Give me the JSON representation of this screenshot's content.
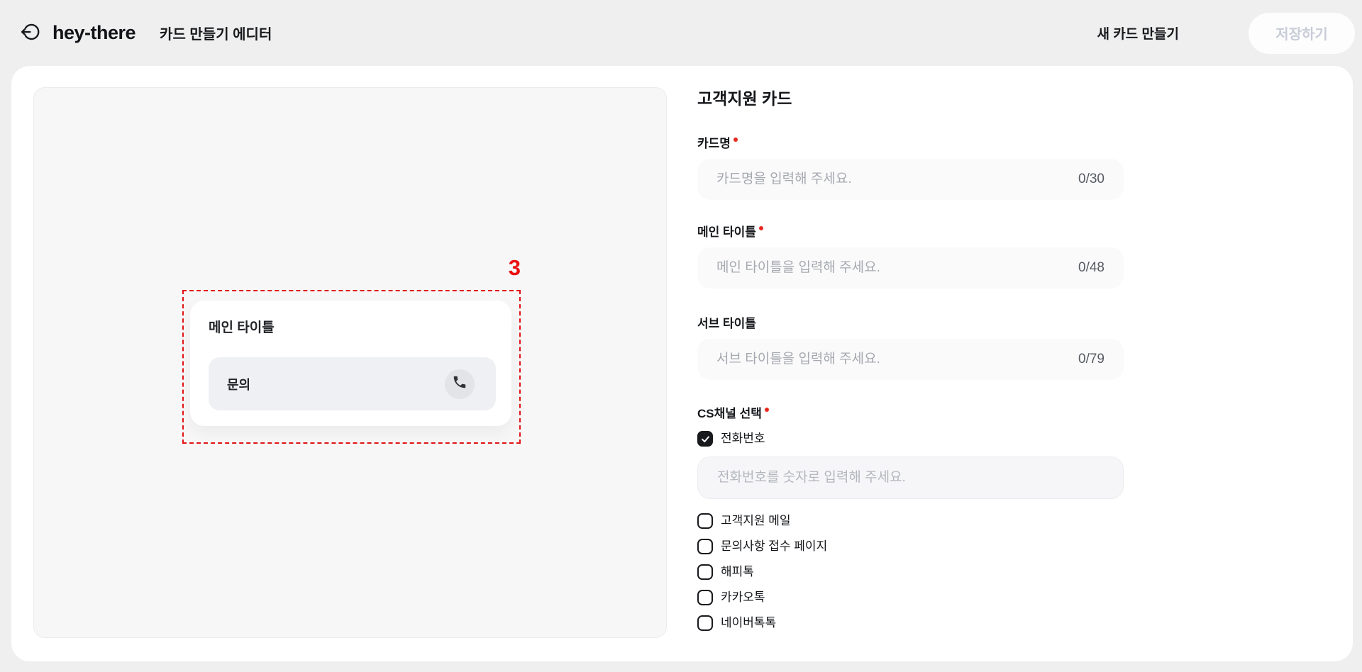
{
  "header": {
    "logo": "hey-there",
    "title": "카드 만들기 에디터",
    "new_card_label": "새 카드 만들기",
    "save_label": "저장하기",
    "save_enabled": false,
    "back_icon": "back-arrow-exit-icon"
  },
  "canvas": {
    "annotation_number": "3",
    "card_preview": {
      "main_title": "메인 타이틀",
      "cta_label": "문의",
      "cta_icon": "phone-icon",
      "selected": true
    }
  },
  "form": {
    "title": "고객지원 카드",
    "fields": [
      {
        "label": "카드명",
        "required": true,
        "placeholder": "카드명을 입력해 주세요.",
        "value": "",
        "counter": "0/30"
      },
      {
        "label": "메인 타이틀",
        "required": true,
        "placeholder": "메인 타이틀을 입력해 주세요.",
        "value": "",
        "counter": "0/48"
      },
      {
        "label": "서브 타이틀",
        "required": false,
        "placeholder": "서브 타이틀을 입력해 주세요.",
        "value": "",
        "counter": "0/79"
      }
    ],
    "cs_channel": {
      "label": "CS채널 선택",
      "required": true,
      "phone_option": {
        "label": "전화번호",
        "checked": true
      },
      "phone_placeholder": "전화번호를 숫자로 입력해 주세요.",
      "phone_value": "",
      "options": [
        {
          "label": "고객지원 메일",
          "checked": false
        },
        {
          "label": "문의사항 접수 페이지",
          "checked": false
        },
        {
          "label": "해피톡",
          "checked": false
        },
        {
          "label": "카카오톡",
          "checked": false
        },
        {
          "label": "네이버톡톡",
          "checked": false
        }
      ]
    }
  },
  "colors": {
    "page_bg": "#efefef",
    "panel_bg": "#ffffff",
    "canvas_bg": "#f7f7f8",
    "accent_red": "#e01414",
    "checkbox_black": "#17191c",
    "disabled_text": "#c8cdd7"
  }
}
